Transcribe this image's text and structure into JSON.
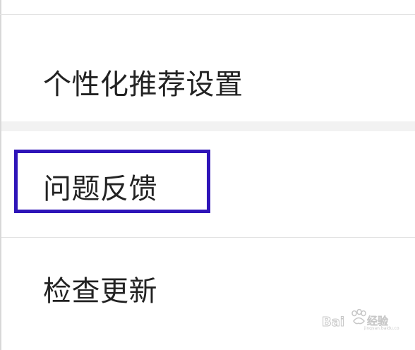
{
  "settings_list": {
    "items": [
      {
        "label": "个性化推荐设置"
      },
      {
        "label": "问题反馈"
      },
      {
        "label": "检查更新"
      }
    ]
  },
  "highlight": {
    "color": "#2e14b8"
  },
  "watermark": {
    "text": "Bai经验",
    "subtext": "jingyan.baidu.com",
    "icon": "baidu-paw-icon"
  }
}
